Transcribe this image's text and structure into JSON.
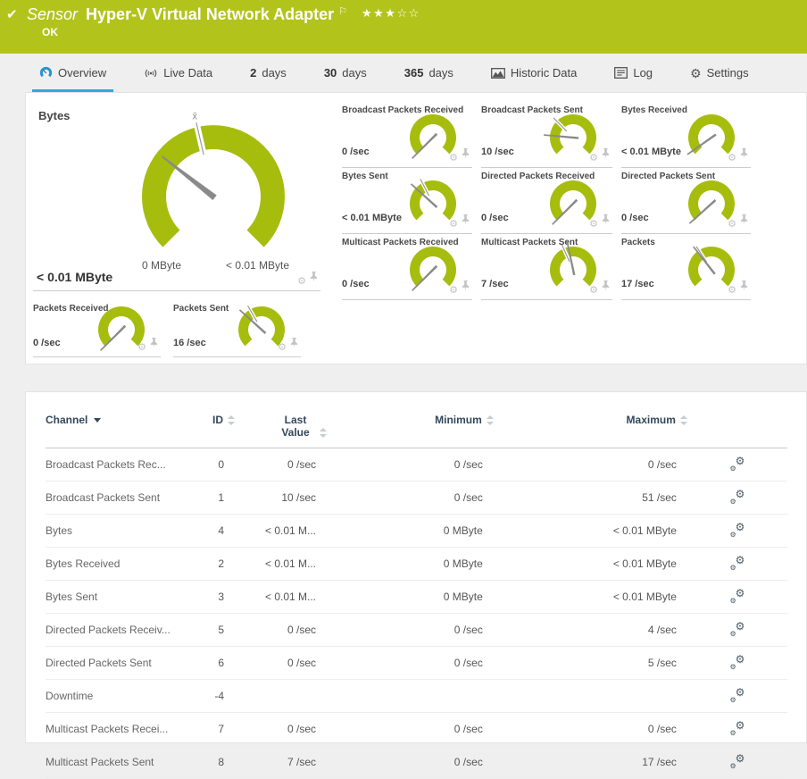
{
  "header": {
    "kind_label": "Sensor",
    "title": "Hyper-V Virtual Network Adapter",
    "status": "OK",
    "stars": "★★★☆☆",
    "flag_icon": "priority-flag"
  },
  "tabs": [
    {
      "id": "overview",
      "icon": "gauge-icon",
      "num": "",
      "label": "Overview",
      "active": true
    },
    {
      "id": "live-data",
      "icon": "live-data-icon",
      "num": "",
      "label": "Live Data",
      "active": false
    },
    {
      "id": "2-days",
      "icon": "",
      "num": "2",
      "label": "days",
      "active": false
    },
    {
      "id": "30-days",
      "icon": "",
      "num": "30",
      "label": "days",
      "active": false
    },
    {
      "id": "365-days",
      "icon": "",
      "num": "365",
      "label": "days",
      "active": false
    },
    {
      "id": "historic-data",
      "icon": "historic-data-icon",
      "num": "",
      "label": "Historic Data",
      "active": false
    },
    {
      "id": "log",
      "icon": "log-icon",
      "num": "",
      "label": "Log",
      "active": false
    },
    {
      "id": "settings",
      "icon": "gear-icon",
      "num": "",
      "label": "Settings",
      "active": false
    }
  ],
  "gauges": {
    "big": {
      "title": "Bytes",
      "value": "< 0.01 MByte",
      "scale_min": "0 MByte",
      "scale_max": "< 0.01 MByte",
      "mean_label": "x̄",
      "needle_deg": -52,
      "notch_deg": -13
    },
    "minis": [
      {
        "title": "Broadcast Packets Received",
        "value": "0 /sec",
        "needle_deg": -135,
        "notch_deg": null
      },
      {
        "title": "Broadcast Packets Sent",
        "value": "10 /sec",
        "needle_deg": -85,
        "notch_deg": -45
      },
      {
        "title": "Bytes Received",
        "value": "< 0.01 MByte",
        "needle_deg": -125,
        "notch_deg": null
      },
      {
        "title": "Bytes Sent",
        "value": "< 0.01 MByte",
        "needle_deg": -48,
        "notch_deg": -27
      },
      {
        "title": "Directed Packets Received",
        "value": "0 /sec",
        "needle_deg": -135,
        "notch_deg": null
      },
      {
        "title": "Directed Packets Sent",
        "value": "0 /sec",
        "needle_deg": -132,
        "notch_deg": null
      },
      {
        "title": "Multicast Packets Received",
        "value": "0 /sec",
        "needle_deg": -135,
        "notch_deg": null
      },
      {
        "title": "Multicast Packets Sent",
        "value": "7 /sec",
        "needle_deg": -12,
        "notch_deg": -24
      },
      {
        "title": "Packets",
        "value": "17 /sec",
        "needle_deg": -38,
        "notch_deg": -33
      }
    ],
    "minis_row2": [
      {
        "title": "Packets Received",
        "value": "0 /sec",
        "needle_deg": -135,
        "notch_deg": null
      },
      {
        "title": "Packets Sent",
        "value": "16 /sec",
        "needle_deg": -48,
        "notch_deg": -30
      }
    ]
  },
  "table": {
    "columns": [
      "Channel",
      "ID",
      "Last Value",
      "Minimum",
      "Maximum"
    ],
    "rows": [
      {
        "channel": "Broadcast Packets Rec...",
        "id": "0",
        "last": "0 /sec",
        "min": "0 /sec",
        "max": "0 /sec"
      },
      {
        "channel": "Broadcast Packets Sent",
        "id": "1",
        "last": "10 /sec",
        "min": "0 /sec",
        "max": "51 /sec"
      },
      {
        "channel": "Bytes",
        "id": "4",
        "last": "< 0.01 M...",
        "min": "0 MByte",
        "max": "< 0.01 MByte"
      },
      {
        "channel": "Bytes Received",
        "id": "2",
        "last": "< 0.01 M...",
        "min": "0 MByte",
        "max": "< 0.01 MByte"
      },
      {
        "channel": "Bytes Sent",
        "id": "3",
        "last": "< 0.01 M...",
        "min": "0 MByte",
        "max": "< 0.01 MByte"
      },
      {
        "channel": "Directed Packets Receiv...",
        "id": "5",
        "last": "0 /sec",
        "min": "0 /sec",
        "max": "4 /sec"
      },
      {
        "channel": "Directed Packets Sent",
        "id": "6",
        "last": "0 /sec",
        "min": "0 /sec",
        "max": "5 /sec"
      },
      {
        "channel": "Downtime",
        "id": "-4",
        "last": "",
        "min": "",
        "max": ""
      },
      {
        "channel": "Multicast Packets Recei...",
        "id": "7",
        "last": "0 /sec",
        "min": "0 /sec",
        "max": "0 /sec"
      },
      {
        "channel": "Multicast Packets Sent",
        "id": "8",
        "last": "7 /sec",
        "min": "0 /sec",
        "max": "17 /sec"
      }
    ]
  },
  "colors": {
    "brand_green": "#b2c41c",
    "gauge_green": "#a7bd0e",
    "accent_blue": "#2fa8e1",
    "header_text": "#33475b",
    "needle_gray": "#8a8a8a"
  }
}
